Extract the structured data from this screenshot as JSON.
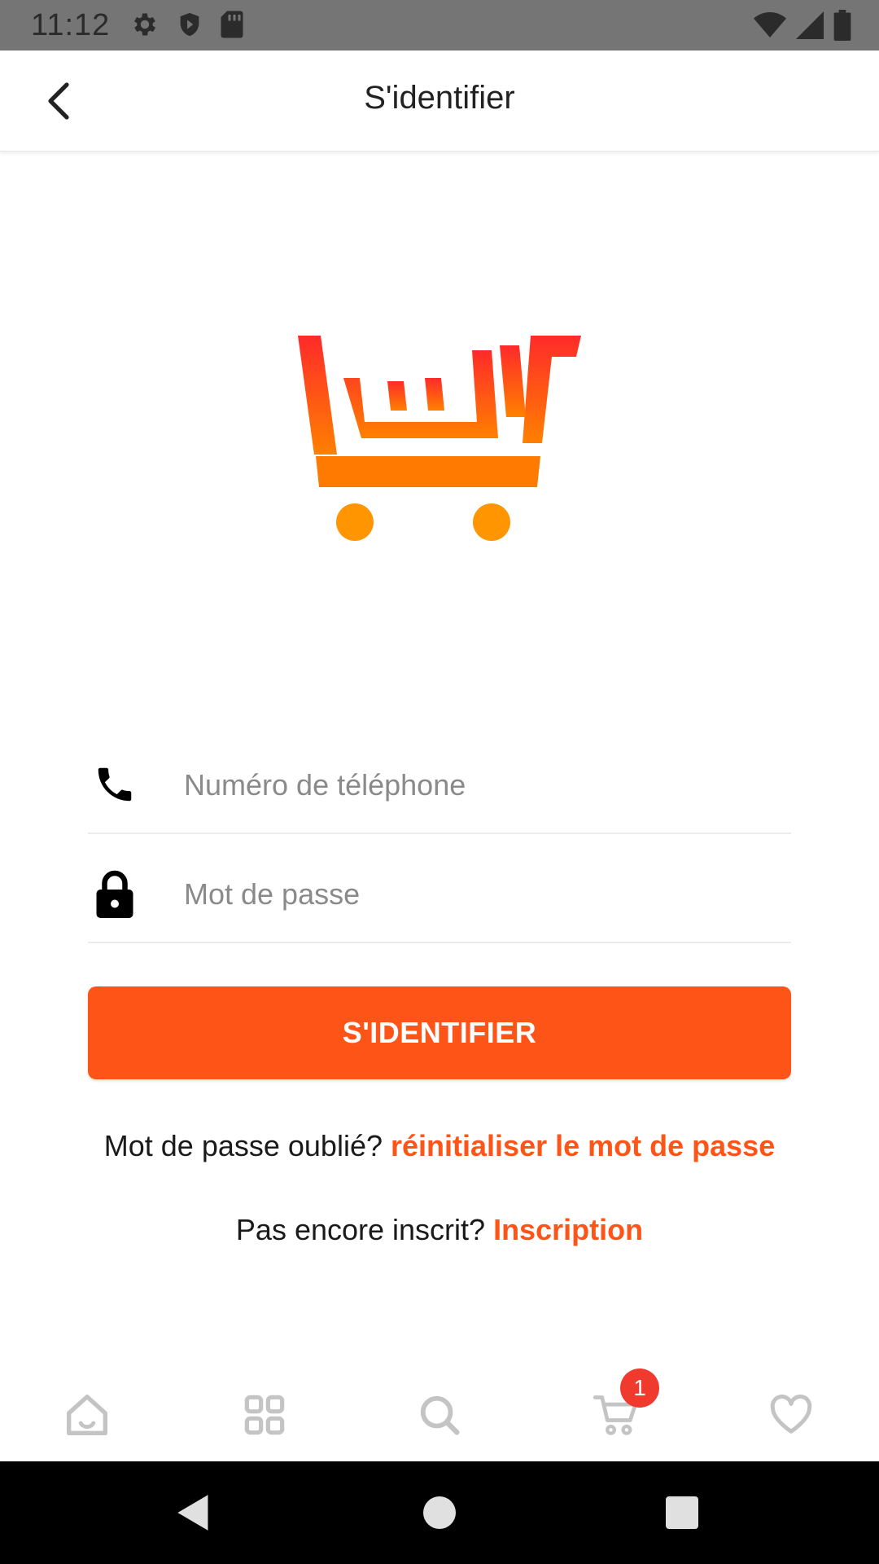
{
  "status_bar": {
    "time": "11:12",
    "left_icons": [
      "gear-icon",
      "shield-icon",
      "sd-card-icon"
    ],
    "right_icons": [
      "wifi-icon",
      "signal-icon",
      "battery-icon"
    ]
  },
  "app_bar": {
    "title": "S'identifier",
    "back_icon": "chevron-left-icon"
  },
  "logo": {
    "colors": [
      "#ff2a2a",
      "#ff7a00",
      "#ff9500"
    ]
  },
  "form": {
    "phone": {
      "icon": "phone-icon",
      "placeholder": "Numéro de téléphone",
      "value": ""
    },
    "password": {
      "icon": "lock-icon",
      "placeholder": "Mot de passe",
      "value": ""
    },
    "submit_label": "S'IDENTIFIER"
  },
  "helpers": {
    "forgot_prefix": "Mot de passe oublié?",
    "forgot_link": "réinitialiser le mot de passe",
    "signup_prefix": "Pas encore inscrit?",
    "signup_link": "Inscription"
  },
  "bottom_nav": {
    "items": [
      {
        "icon": "home-icon"
      },
      {
        "icon": "grid-icon"
      },
      {
        "icon": "search-icon"
      },
      {
        "icon": "cart-icon"
      },
      {
        "icon": "heart-icon"
      }
    ],
    "cart_badge": "1"
  },
  "colors": {
    "accent": "#ff5418",
    "badge": "#f03a2e",
    "nav_icon": "#c4c4c4"
  }
}
